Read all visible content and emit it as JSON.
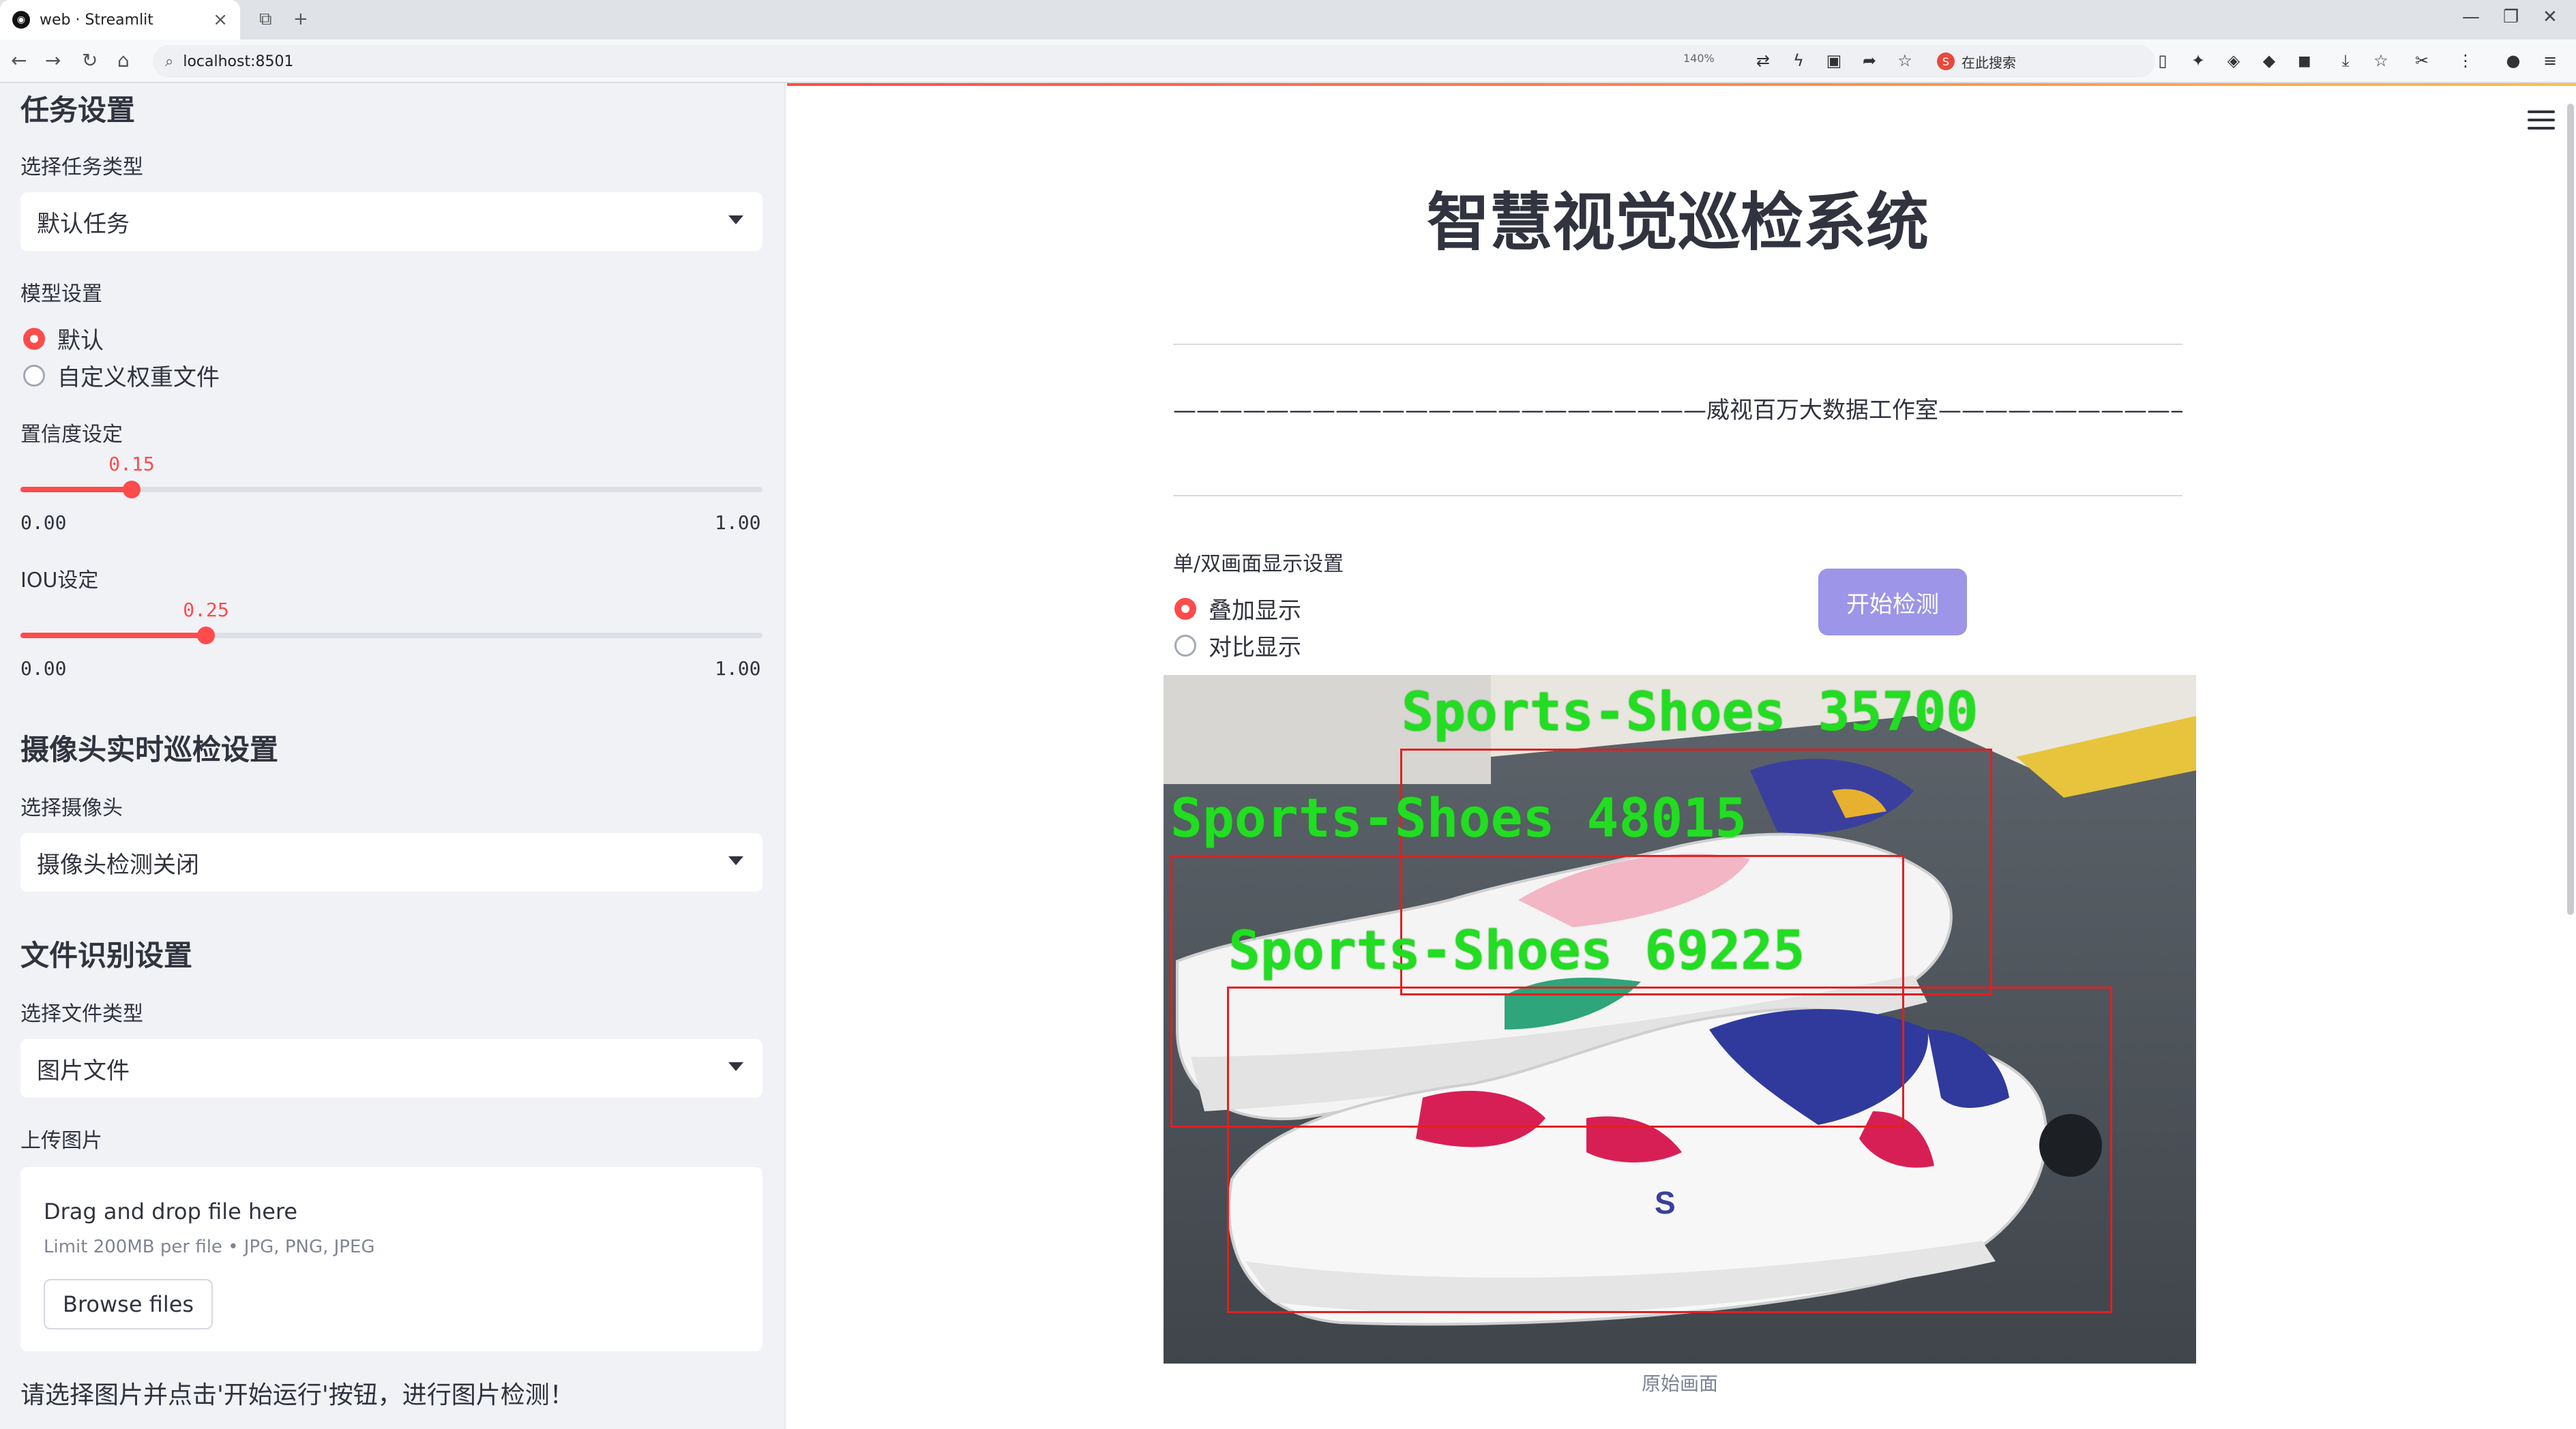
{
  "browser": {
    "tab_title": "web · Streamlit",
    "url": "localhost:8501",
    "zoom": "140%",
    "search_placeholder": "在此搜索"
  },
  "sidebar": {
    "task_header": "任务设置",
    "task_type_label": "选择任务类型",
    "task_type_value": "默认任务",
    "model_label": "模型设置",
    "model_options": [
      "默认",
      "自定义权重文件"
    ],
    "model_selected": "默认",
    "conf_label": "置信度设定",
    "conf_value": "0.15",
    "conf_min": "0.00",
    "conf_max": "1.00",
    "iou_label": "IOU设定",
    "iou_value": "0.25",
    "iou_min": "0.00",
    "iou_max": "1.00",
    "camera_header": "摄像头实时巡检设置",
    "camera_label": "选择摄像头",
    "camera_value": "摄像头检测关闭",
    "file_header": "文件识别设置",
    "file_type_label": "选择文件类型",
    "file_type_value": "图片文件",
    "upload_label": "上传图片",
    "upload_drop": "Drag and drop file here",
    "upload_limit": "Limit 200MB per file • JPG, PNG, JPEG",
    "browse_button": "Browse files",
    "hint": "请选择图片并点击'开始运行'按钮，进行图片检测！"
  },
  "main": {
    "title": "智慧视觉巡检系统",
    "studio": "———————————————————————威视百万大数据工作室————————————————————————",
    "display_label": "单/双画面显示设置",
    "display_options": [
      "叠加显示",
      "对比显示"
    ],
    "display_selected": "叠加显示",
    "start_button": "开始检测",
    "image_caption": "原始画面",
    "detections": [
      {
        "label": "Sports-Shoes",
        "score": "35700"
      },
      {
        "label": "Sports-Shoes",
        "score": "48015"
      },
      {
        "label": "Sports-Shoes",
        "score": "69225"
      }
    ],
    "colors": {
      "accent": "#ff4b4b",
      "button": "#9c95e8",
      "box": "#e02020",
      "box_label": "#22dd22"
    }
  }
}
